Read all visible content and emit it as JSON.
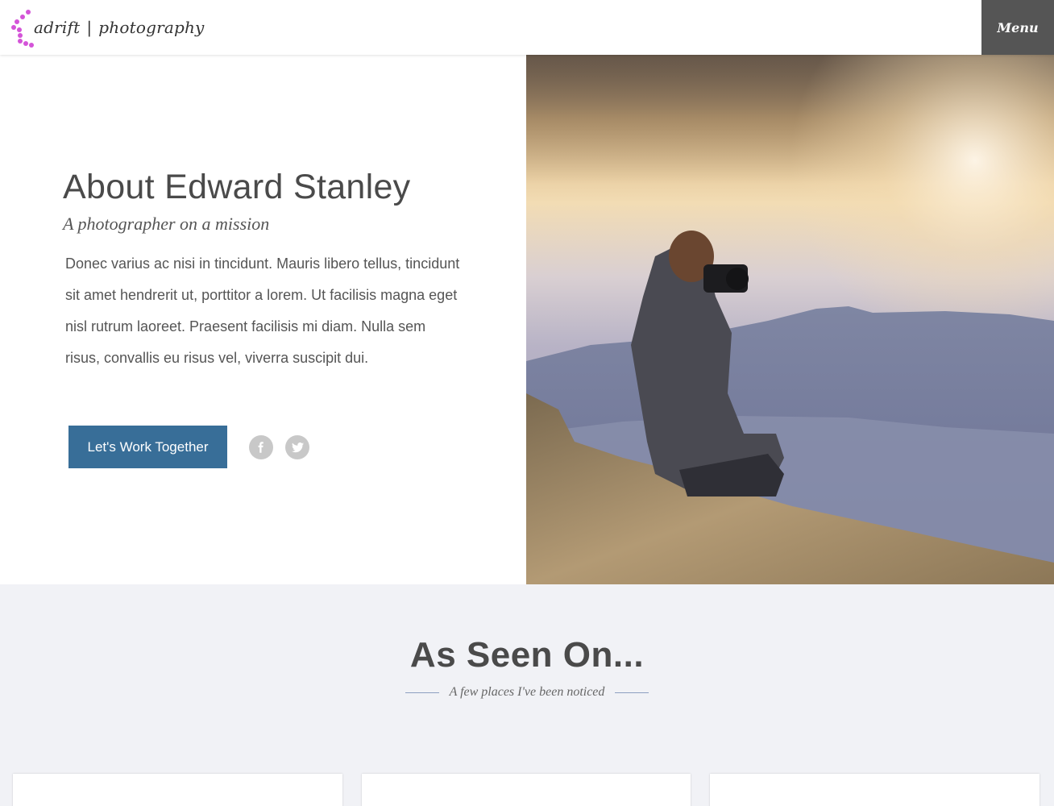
{
  "header": {
    "brand_name": "adrift",
    "brand_separator": "|",
    "brand_tagline": "photography",
    "menu_label": "Menu",
    "brand_color": "#d454d8"
  },
  "about": {
    "title": "About Edward Stanley",
    "subtitle": "A photographer on a mission",
    "body": "Donec varius ac nisi in tincidunt. Mauris libero tellus, tincidunt sit amet hendrerit ut, porttitor a lorem. Ut facilisis magna eget nisl rutrum laoreet. Praesent facilisis mi diam. Nulla sem risus, convallis eu risus vel, viverra suscipit dui.",
    "cta_label": "Let's Work Together",
    "cta_color": "#386e98",
    "social": [
      {
        "icon": "facebook-icon",
        "glyph": "f"
      },
      {
        "icon": "twitter-icon",
        "glyph": "t"
      }
    ],
    "photo_icon": "photographer-on-cliff-image"
  },
  "seen_on": {
    "title": "As Seen On...",
    "subtitle": "A few places I've been noticed",
    "background": "#f1f2f6"
  }
}
